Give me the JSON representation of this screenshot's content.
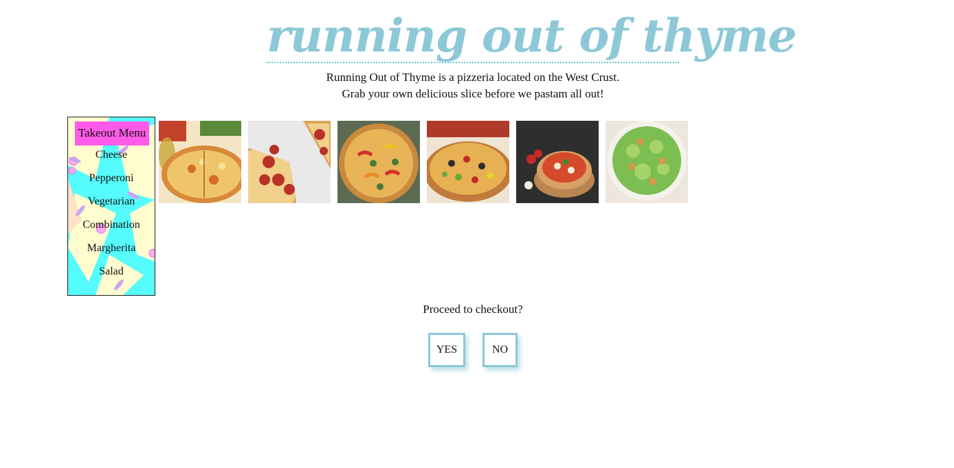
{
  "header": {
    "logo_text": "running out of thyme",
    "intro_line1": "Running Out of Thyme is a pizzeria located on the West Crust.",
    "intro_line2": "Grab your own delicious slice before we pastam all out!"
  },
  "menu": {
    "title": "Takeout Menu",
    "items": [
      "Cheese",
      "Pepperoni",
      "Vegetarian",
      "Combination",
      "Margherita",
      "Salad"
    ]
  },
  "gallery": [
    {
      "name": "cheese-pizza"
    },
    {
      "name": "pepperoni-pizza"
    },
    {
      "name": "vegetarian-pizza"
    },
    {
      "name": "combination-pizza"
    },
    {
      "name": "margherita-pizza"
    },
    {
      "name": "salad"
    }
  ],
  "checkout": {
    "question": "Proceed to checkout?",
    "yes_label": "YES",
    "no_label": "NO"
  },
  "colors": {
    "logo": "#8cc8d8",
    "menu_bg": "#55fbfd",
    "menu_header": "#ff5ae8",
    "button_border": "#8cc8d8"
  }
}
